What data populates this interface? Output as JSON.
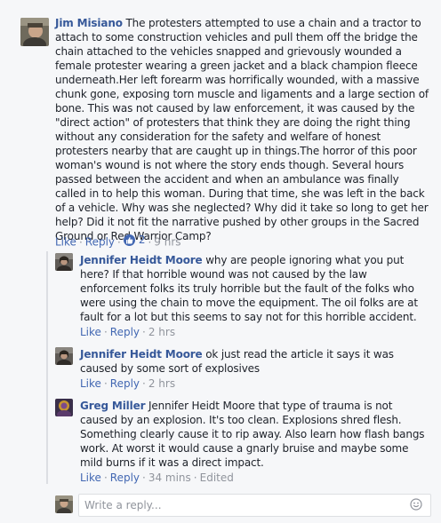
{
  "comments": [
    {
      "author": "Jim Misiano",
      "text": " The protesters attempted to use a chain and a tractor to attach to some construction vehicles and pull them off the bridge the chain attached to the vehicles snapped and grievously wounded a female protester wearing a green jacket and a black champion fleece underneath.Her left forearm was horrifically wounded, with a massive chunk gone, exposing torn muscle and ligaments and a large section of bone. This was not caused by law enforcement, it was caused by the \"direct action\" of protesters that think they are doing the right thing without any consideration for the safety and welfare of honest protesters nearby that are caught up in things.The horror of this poor woman's wound is not where the story ends though. Several hours passed between the accident and when an ambulance was finally called in to help this woman. During that time, she was left in the back of a vehicle. Why was she neglected? Why did it take so long to get her help? Did it not fit the narrative pushed by other groups in the Sacred Ground or Red Warrior Camp?",
      "like_label": "Like",
      "reply_label": "Reply",
      "like_count": "2",
      "time": "9 hrs"
    },
    {
      "author": "Jennifer Heidt Moore",
      "text": " why are people ignoring what you put here? If that horrible wound was not caused by the law enforcement folks its truly horrible but the fault of the folks who were using the chain to move the equipment. The oil folks are at fault for a lot but this seems to say not for this horrible accident.",
      "like_label": "Like",
      "reply_label": "Reply",
      "time": "2 hrs"
    },
    {
      "author": "Jennifer Heidt Moore",
      "text": " ok just read the article it says it was caused by some sort of explosives",
      "like_label": "Like",
      "reply_label": "Reply",
      "time": "2 hrs"
    },
    {
      "author": "Greg Miller",
      "text": " Jennifer Heidt Moore that type of trauma is not caused by an explosion. It's too clean. Explosions shred flesh. Something clearly cause it to rip away. Also learn how flash bangs work. At worst it would cause a gnarly bruise and maybe some mild burns if it was a direct impact.",
      "like_label": "Like",
      "reply_label": "Reply",
      "time": "34 mins",
      "edited": "Edited"
    }
  ],
  "reply_box": {
    "placeholder": "Write a reply...",
    "icon": "emoji-icon"
  },
  "colors": {
    "author": "#365899",
    "link": "#4267b2",
    "meta": "#90949c",
    "background": "#f6f7f9"
  }
}
